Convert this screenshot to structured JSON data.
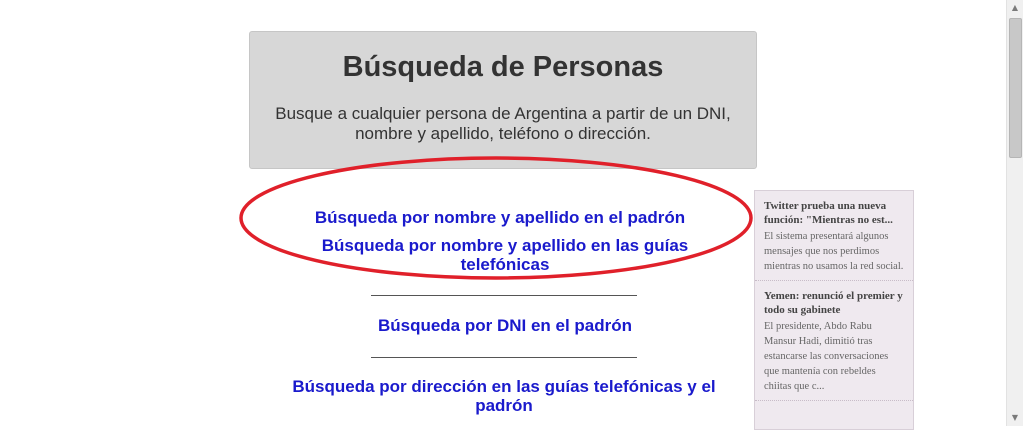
{
  "header": {
    "title": "Búsqueda de Personas",
    "description": "Busque a cualquier persona de Argentina a partir de un DNI, nombre y apellido, teléfono o dirección."
  },
  "links": {
    "padron_nombre": "Búsqueda por nombre y apellido en el padrón",
    "guias_nombre": "Búsqueda por nombre y apellido en las guías telefónicas",
    "dni_padron": "Búsqueda por DNI en el padrón",
    "direccion": "Búsqueda por dirección en las guías telefónicas y el padrón"
  },
  "annotation": {
    "ellipse_color": "#e0202a"
  },
  "news": [
    {
      "title": "Twitter prueba una nueva función: \"Mientras no est...",
      "summary": "El sistema presentará algunos mensajes que nos perdimos mientras no usamos la red social."
    },
    {
      "title": "Yemen: renunció el premier y todo su gabinete",
      "summary": "El presidente, Abdo Rabu Mansur Hadi, dimitió tras estancarse las conversaciones que mantenía con rebeldes chiitas que c..."
    }
  ],
  "scrollbar": {
    "up_icon": "triangle-up",
    "down_icon": "triangle-down"
  },
  "colors": {
    "link": "#1a1acc",
    "header_bg": "#d7d7d7",
    "news_bg": "#efe9ef"
  }
}
